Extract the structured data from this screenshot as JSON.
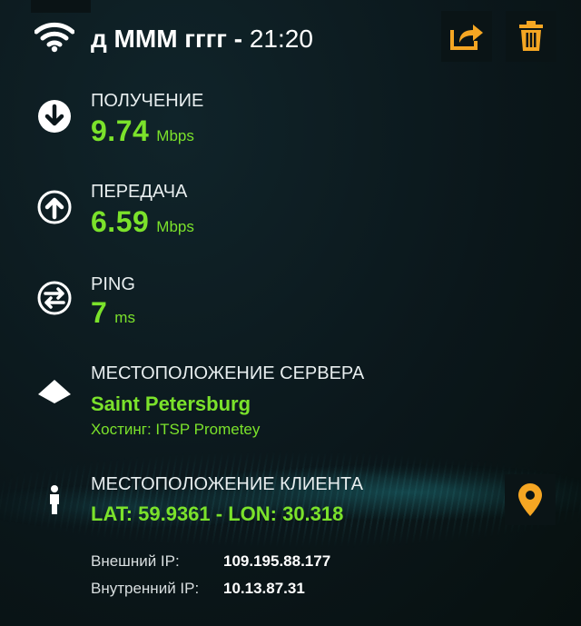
{
  "header": {
    "name": "д МММ гггг - ",
    "time": "21:20"
  },
  "download": {
    "label": "ПОЛУЧЕНИЕ",
    "value": "9.74",
    "unit": "Mbps"
  },
  "upload": {
    "label": "ПЕРЕДАЧА",
    "value": "6.59",
    "unit": "Mbps"
  },
  "ping": {
    "label": "PING",
    "value": "7",
    "unit": "ms"
  },
  "server": {
    "label": "МЕСТОПОЛОЖЕНИЕ СЕРВЕРА",
    "city": "Saint Petersburg",
    "hosting_label": "Хостинг: ",
    "hosting_value": "ITSP Prometey"
  },
  "client": {
    "label": "МЕСТОПОЛОЖЕНИЕ КЛИЕНТА",
    "coords": "LAT: 59.9361 - LON: 30.318"
  },
  "ip": {
    "external_label": "Внешний IP:",
    "external_value": "109.195.88.177",
    "internal_label": "Внутренний IP:",
    "internal_value": "10.13.87.31"
  },
  "colors": {
    "accent_green": "#7be22b",
    "icon_orange": "#f5a623",
    "background": "#0b171b"
  },
  "icons": [
    "wifi-icon",
    "share-icon",
    "trash-icon",
    "download-arrow-icon",
    "upload-arrow-icon",
    "ping-arrows-icon",
    "server-location-icon",
    "person-icon",
    "map-pin-icon"
  ]
}
